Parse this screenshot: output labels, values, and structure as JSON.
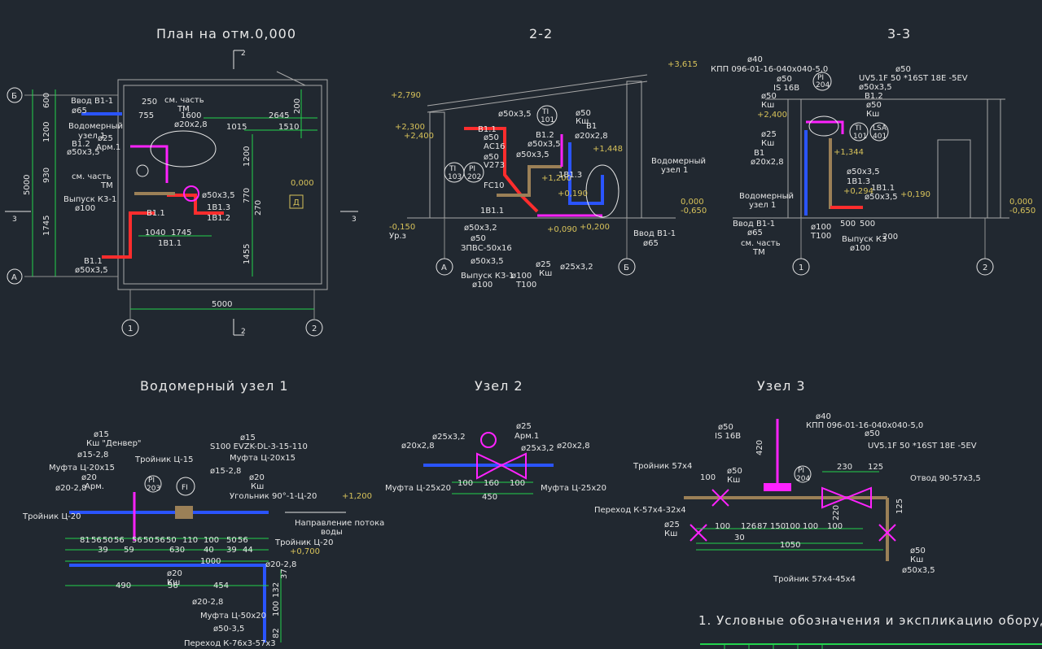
{
  "titles": {
    "plan": "План на отм.0,000",
    "sec22": "2-2",
    "sec33": "3-3",
    "node1": "Водомерный узел 1",
    "node2": "Узел 2",
    "node3": "Узел 3"
  },
  "grid_axes": {
    "A": "А",
    "B": "Б",
    "one": "1",
    "two": "2"
  },
  "plan": {
    "cut2": "2",
    "cut3": "3",
    "dims": {
      "d600": "600",
      "d1200a": "1200",
      "d930": "930",
      "d1745": "1745",
      "d5000v": "5000",
      "d250": "250",
      "d755": "755",
      "d1600": "1600",
      "d1015": "1015",
      "d1510": "1510",
      "d2645": "2645",
      "d200": "200",
      "d1200b": "1200",
      "d770": "770",
      "d270": "270",
      "d1455": "1455",
      "d1040": "1040",
      "d1745b": "1745",
      "d5000h": "5000"
    },
    "labels": {
      "vvod": "Ввод В1-1",
      "vvod_d": "ø65",
      "vodomer": "Водомерный",
      "uzel": "узел 1",
      "b12": "В1.2",
      "b12d": "ø50х3,5",
      "d25": "ø25",
      "arm": "Арм.1",
      "sm": "см. часть",
      "tm": "ТМ",
      "sm2": "см. часть",
      "tm2": "ТМ",
      "d20": "ø20х2,8",
      "vypusk": "Выпуск К3-1",
      "vypusk_d": "ø100",
      "b1a": "В1.1",
      "b11": "1В1.1",
      "b12r": "1В1.2",
      "b13": "1В1.3",
      "d50": "ø50х3,5",
      "b11b": "В1.1",
      "b11bd": "ø50х3,5",
      "mark": "0,000",
      "room": "Д"
    }
  },
  "sec22": {
    "lvl": [
      "+2,790",
      "+2,300",
      "+2,400",
      "+3,615",
      "-0,150",
      "Ур.з",
      "+1,448",
      "+1,200",
      "+0,190",
      "+0,090",
      "+0,200",
      "0,000",
      "-0,650"
    ],
    "labels": {
      "b11": "В1.1",
      "d50": "ø50",
      "ac": "АС16",
      "d50b": "ø50",
      "v": "V273",
      "d50x": "ø50х3,5",
      "ti": "TI",
      "ti_n": "103",
      "pi": "PI",
      "pi_n": "202",
      "fc": "FC10",
      "b12": "В1.2",
      "d50x2": "ø50х3,5",
      "b1": "В1",
      "d20": "ø20х2,8",
      "ks": "Кш",
      "d50k": "ø50",
      "ti2": "TI",
      "ti2n": "101",
      "b13": "1В1.3",
      "vodomer": "Водомерный",
      "uzel": "узел 1",
      "d50x32": "ø50х3,2",
      "d50c": "ø50",
      "zpvs": "ЗПВС-50х16",
      "d50x35": "ø50х3,5",
      "vyp": "Выпуск К3-1",
      "vyp_d": "ø100",
      "d100": "ø100",
      "t100": "Т100",
      "d25": "ø25",
      "ks2": "Кш",
      "d25x": "ø25х3,2",
      "vvod": "Ввод В1-1",
      "vvod_d": "ø65",
      "b11a": "1В1.1"
    }
  },
  "sec33": {
    "labels": {
      "d40": "ø40",
      "kpp": "КПП 096-01-16-040х040-5,0",
      "d50a": "ø50",
      "is": "IS 16В",
      "pi": "PI",
      "pi_n": "204",
      "d50b": "ø50",
      "ks": "Кш",
      "d25": "ø25",
      "ks2": "Кш",
      "d50c": "ø50",
      "uv": "UV5.1F 50 *16ST 18E -5EV",
      "d50x": "ø50х3,5",
      "b12": "В1.2",
      "d50d": "ø50",
      "ks3": "Кш",
      "ti": "TI",
      "ti_n": "101",
      "lsa": "LSA",
      "lsa_n": "401",
      "b1": "В1",
      "d20": "ø20х2,8",
      "d50x2": "ø50х3,5",
      "b13": "1В1.3",
      "b11": "1В1.1",
      "d50x3": "ø50х3,5",
      "vodomer": "Водомерный",
      "uzel": "узел 1",
      "vvod": "Ввод В1-1",
      "vvod_d": "ø65",
      "sm": "см. часть",
      "tm": "ТМ",
      "d100": "ø100",
      "t100": "Т100",
      "vyp": "Выпуск К3",
      "vyp_d": "ø100",
      "dim500a": "500",
      "dim500b": "500",
      "dim200": "200"
    },
    "lvl": [
      "+2,400",
      "+1,344",
      "+0,294",
      "+0,190",
      "0,000",
      "-0,650"
    ]
  },
  "node1": {
    "labels": {
      "d15a": "ø15",
      "ks": "Кш \"Денвер\"",
      "d15b": "ø15-2,8",
      "d20a": "ø20",
      "mufta": "Муфта Ц-20х15",
      "d20b": "ø20-2,8",
      "tro": "Тройник Ц-20",
      "arm": "Арм.",
      "troy15": "Тройник Ц-15",
      "pi": "PI",
      "pi_n": "203",
      "d15c": "ø15",
      "s100": "S100 EVZK-DL-3-15-110",
      "mufta2": "Муфта Ц-20х15",
      "fi": "FI",
      "d15d": "ø15-2,8",
      "d20c": "ø20",
      "ks2": "Кш",
      "uvol": "Угольник 90°-1-Ц-20",
      "napr": "Направление потока",
      "vody": "воды",
      "tro2": "Тройник Ц-20",
      "lvl": "+0,700",
      "lvl2": "+1,200",
      "d20d": "ø20",
      "ks3": "Кш",
      "d20e": "ø20-2,8",
      "d20f": "ø20-2,8",
      "mufta3": "Муфта Ц-50х20",
      "d50": "ø50-3,5",
      "perehod": "Переход К-76х3-57х3"
    },
    "dims": [
      "81",
      "56",
      "50",
      "56",
      "56",
      "50",
      "56",
      "50",
      "110",
      "100",
      "50",
      "56",
      "39",
      "59",
      "630",
      "40",
      "39",
      "44",
      "1000",
      "490",
      "56",
      "454",
      "132",
      "37",
      "100",
      "82"
    ]
  },
  "node2": {
    "labels": {
      "d25": "ø25",
      "arm": "Арм.1",
      "d20a": "ø20х2,8",
      "d25a": "ø25х3,2",
      "d25b": "ø25х3,2",
      "d20b": "ø20х2,8",
      "mufta1": "Муфта Ц-25х20",
      "mufta2": "Муфта Ц-25х20"
    },
    "dims": [
      "100",
      "160",
      "100",
      "450"
    ]
  },
  "node3": {
    "labels": {
      "d40": "ø40",
      "kpp": "КПП 096-01-16-040х040-5,0",
      "d50a": "ø50",
      "is": "IS 16В",
      "d50b": "ø50",
      "ks": "Кш",
      "tro": "Тройник 57х4",
      "perehod": "Переход К-57х4-32х4",
      "d25": "ø25",
      "ks2": "Кш",
      "pi": "PI",
      "pi_n": "204",
      "uv": "UV5.1F 50 *16ST 18E -5EV",
      "otvod": "Отвод 90-57х3,5",
      "d50c": "ø50",
      "ks3": "Кш",
      "d50x": "ø50х3,5",
      "tro2": "Тройник 57х4-45х4"
    },
    "dims": [
      "100",
      "100",
      "100",
      "126",
      "87",
      "150",
      "100",
      "30",
      "1050",
      "230",
      "125",
      "220",
      "100",
      "125",
      "420"
    ]
  },
  "note": "1. Условные обозначения и экспликацию оборуд"
}
